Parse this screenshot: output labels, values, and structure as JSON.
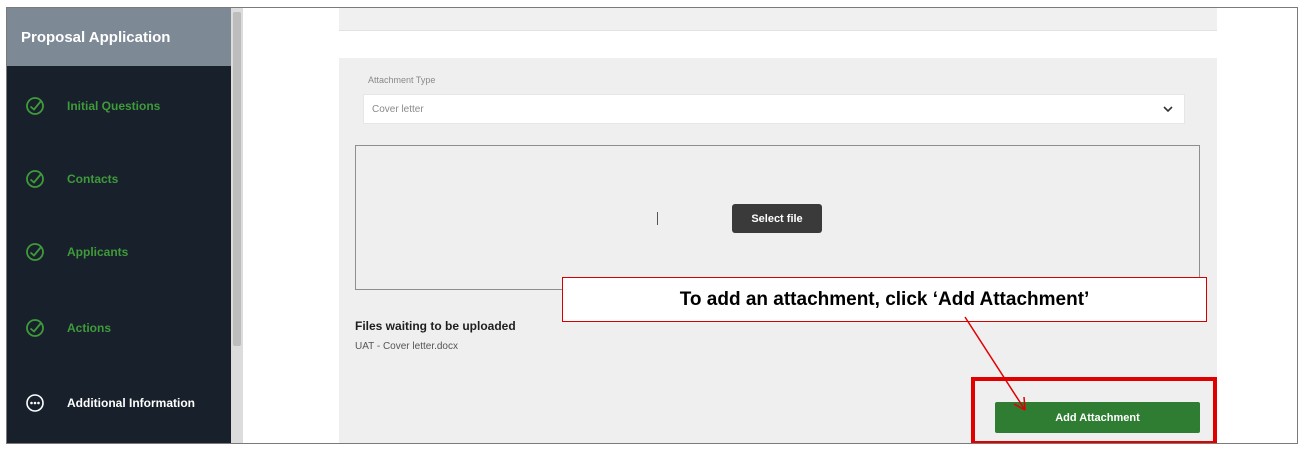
{
  "sidebar": {
    "title": "Proposal Application",
    "items": [
      {
        "label": "Initial Questions",
        "icon": "check-circle-icon",
        "status": "complete"
      },
      {
        "label": "Contacts",
        "icon": "check-circle-icon",
        "status": "complete"
      },
      {
        "label": "Applicants",
        "icon": "check-circle-icon",
        "status": "complete"
      },
      {
        "label": "Actions",
        "icon": "check-circle-icon",
        "status": "complete"
      },
      {
        "label": "Additional Information",
        "icon": "more-circle-icon",
        "status": "current"
      }
    ]
  },
  "attachment": {
    "type_label": "Attachment Type",
    "type_value": "Cover letter",
    "select_file_label": "Select file",
    "files_waiting_title": "Files waiting to be uploaded",
    "files": [
      "UAT - Cover letter.docx"
    ],
    "add_button_label": "Add Attachment"
  },
  "annotation": {
    "callout_text": "To add an attachment, click ‘Add Attachment’"
  },
  "colors": {
    "sidebar_bg": "#17202b",
    "sidebar_header_bg": "#7d8a96",
    "complete_green": "#3f9a3a",
    "button_green": "#2e7d32",
    "highlight_red": "#e00000"
  }
}
